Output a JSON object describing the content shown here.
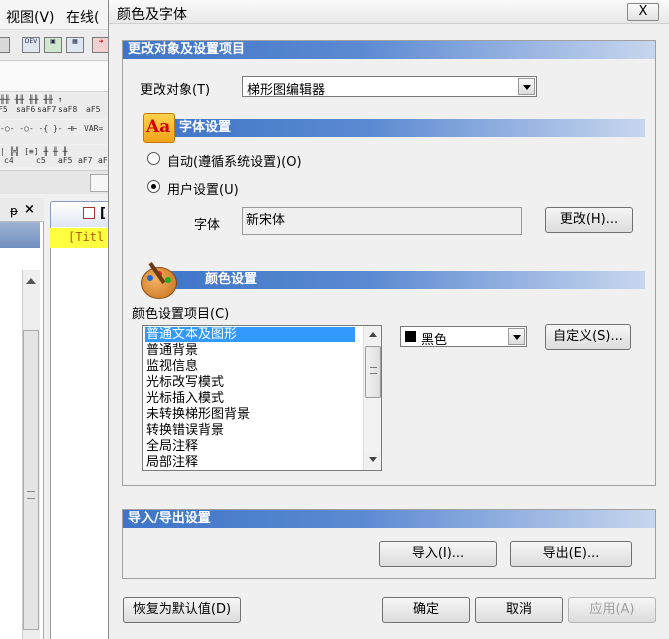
{
  "app_menu": {
    "view": "视图(V)",
    "online": "在线("
  },
  "toolbar_small": {
    "r1": [
      "F5",
      "saF6",
      "saF7",
      "saF8",
      "aF5"
    ],
    "r2": [
      "c4",
      "c5",
      "aF5",
      "aF7",
      "aF8"
    ],
    "r3": "VAR="
  },
  "panel": {
    "pin": "ᵽ",
    "close": "×"
  },
  "editor": {
    "tab_text": "[",
    "title_text": "[Titl"
  },
  "dialog": {
    "title": "颜色及字体",
    "close": "X",
    "group_change": {
      "header": "更改对象及设置项目",
      "target_label": "更改对象(T)",
      "target_value": "梯形图编辑器"
    },
    "font_settings": {
      "header": "字体设置",
      "auto_label": "自动(遵循系统设置)(O)",
      "user_label": "用户设置(U)",
      "font_label": "字体",
      "font_value": "新宋体",
      "change_button": "更改(H)..."
    },
    "color_settings": {
      "header": "颜色设置",
      "items_label": "颜色设置项目(C)",
      "items": [
        "普通文本及图形",
        "普通背景",
        "监视信息",
        "光标改写模式",
        "光标插入模式",
        "未转换梯形图背景",
        "转换错误背景",
        "全局注释",
        "局部注释"
      ],
      "selected_index": 0,
      "color_value": "黑色",
      "color_swatch": "#000000",
      "custom_button": "自定义(S)..."
    },
    "import_export": {
      "header": "导入/导出设置",
      "import_button": "导入(I)...",
      "export_button": "导出(E)..."
    },
    "footer": {
      "restore_button": "恢复为默认值(D)",
      "ok_button": "确定",
      "cancel_button": "取消",
      "apply_button": "应用(A)"
    }
  },
  "colors": {
    "accent_blue": "#3f74c8",
    "selection": "#3399ff",
    "editor_title_bg": "#ffff40"
  }
}
